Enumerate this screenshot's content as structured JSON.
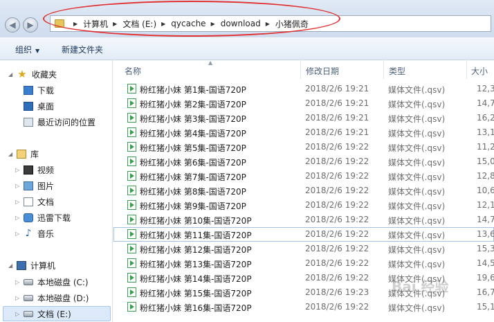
{
  "address": {
    "crumbs": [
      "计算机",
      "文档 (E:)",
      "qycache",
      "download",
      "小猪佩奇"
    ]
  },
  "toolbar": {
    "organize_label": "组织",
    "new_folder_label": "新建文件夹"
  },
  "nav": {
    "favorites_label": "收藏夹",
    "downloads_label": "下载",
    "desktop_label": "桌面",
    "recent_label": "最近访问的位置",
    "libraries_label": "库",
    "video_label": "视频",
    "pictures_label": "图片",
    "documents_label": "文档",
    "thunder_label": "迅雷下载",
    "music_label": "音乐",
    "computer_label": "计算机",
    "drive_c_label": "本地磁盘 (C:)",
    "drive_d_label": "本地磁盘 (D:)",
    "drive_e_label": "文档 (E:)"
  },
  "columns": {
    "name": "名称",
    "date": "修改日期",
    "type": "类型",
    "size": "大小"
  },
  "files": [
    {
      "name": "粉红猪小妹 第1集-国语720P",
      "date": "2018/2/6 19:21",
      "type": "媒体文件(.qsv)",
      "size": "12,3"
    },
    {
      "name": "粉红猪小妹 第2集-国语720P",
      "date": "2018/2/6 19:21",
      "type": "媒体文件(.qsv)",
      "size": "14,7"
    },
    {
      "name": "粉红猪小妹 第3集-国语720P",
      "date": "2018/2/6 19:21",
      "type": "媒体文件(.qsv)",
      "size": "16,2"
    },
    {
      "name": "粉红猪小妹 第4集-国语720P",
      "date": "2018/2/6 19:21",
      "type": "媒体文件(.qsv)",
      "size": "13,1"
    },
    {
      "name": "粉红猪小妹 第5集-国语720P",
      "date": "2018/2/6 19:22",
      "type": "媒体文件(.qsv)",
      "size": "11,2"
    },
    {
      "name": "粉红猪小妹 第6集-国语720P",
      "date": "2018/2/6 19:22",
      "type": "媒体文件(.qsv)",
      "size": "15,0"
    },
    {
      "name": "粉红猪小妹 第7集-国语720P",
      "date": "2018/2/6 19:22",
      "type": "媒体文件(.qsv)",
      "size": "12,8"
    },
    {
      "name": "粉红猪小妹 第8集-国语720P",
      "date": "2018/2/6 19:22",
      "type": "媒体文件(.qsv)",
      "size": "10,6"
    },
    {
      "name": "粉红猪小妹 第9集-国语720P",
      "date": "2018/2/6 19:22",
      "type": "媒体文件(.qsv)",
      "size": "12,1"
    },
    {
      "name": "粉红猪小妹 第10集-国语720P",
      "date": "2018/2/6 19:22",
      "type": "媒体文件(.qsv)",
      "size": "14,7"
    },
    {
      "name": "粉红猪小妹 第11集-国语720P",
      "date": "2018/2/6 19:22",
      "type": "媒体文件(.qsv)",
      "size": "13,6"
    },
    {
      "name": "粉红猪小妹 第12集-国语720P",
      "date": "2018/2/6 19:22",
      "type": "媒体文件(.qsv)",
      "size": "15,3"
    },
    {
      "name": "粉红猪小妹 第13集-国语720P",
      "date": "2018/2/6 19:22",
      "type": "媒体文件(.qsv)",
      "size": "14,5"
    },
    {
      "name": "粉红猪小妹 第14集-国语720P",
      "date": "2018/2/6 19:22",
      "type": "媒体文件(.qsv)",
      "size": "19,6"
    },
    {
      "name": "粉红猪小妹 第15集-国语720P",
      "date": "2018/2/6 19:23",
      "type": "媒体文件(.qsv)",
      "size": "16,7"
    },
    {
      "name": "粉红猪小妹 第16集-国语720P",
      "date": "2018/2/6 19:22",
      "type": "媒体文件(.qsv)",
      "size": "15,1"
    }
  ],
  "colors": {
    "annotation_oval": "#e23030",
    "media_icon": "#36a04e"
  }
}
